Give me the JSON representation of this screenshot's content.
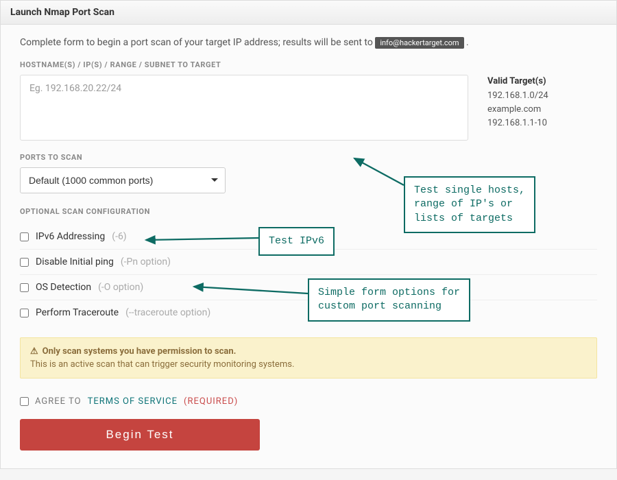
{
  "panel": {
    "title": "Launch Nmap Port Scan",
    "intro_prefix": "Complete form to begin a port scan of your target IP address; results will be sent to ",
    "email_badge": "info@hackertarget.com",
    "intro_suffix": "."
  },
  "target": {
    "label": "HOSTNAME(S) / IP(S) / RANGE / SUBNET TO TARGET",
    "placeholder": "Eg. 192.168.20.22/24",
    "valid_title": "Valid Target(s)",
    "valid_examples": [
      "192.168.1.0/24",
      "example.com",
      "192.168.1.1-10"
    ]
  },
  "ports": {
    "label": "PORTS TO SCAN",
    "selected": "Default (1000 common ports)"
  },
  "options": {
    "label": "OPTIONAL SCAN CONFIGURATION",
    "items": [
      {
        "text": "IPv6 Addressing",
        "hint": "(-6)"
      },
      {
        "text": "Disable Initial ping",
        "hint": "(-Pn option)"
      },
      {
        "text": "OS Detection",
        "hint": "(-O option)"
      },
      {
        "text": "Perform Traceroute",
        "hint": "(--traceroute option)"
      }
    ]
  },
  "warning": {
    "title": "Only scan systems you have permission to scan.",
    "body": "This is an active scan that can trigger security monitoring systems."
  },
  "agree": {
    "prefix": "AGREE TO",
    "link": "TERMS OF SERVICE",
    "required": "(REQUIRED)"
  },
  "submit": {
    "label": "Begin Test"
  },
  "callouts": {
    "targets": "Test single hosts,\nrange of IP's or\nlists of targets",
    "ipv6": "Test IPv6",
    "simple": "Simple form options for\ncustom port scanning"
  },
  "colors": {
    "teal": "#0d6b63"
  }
}
